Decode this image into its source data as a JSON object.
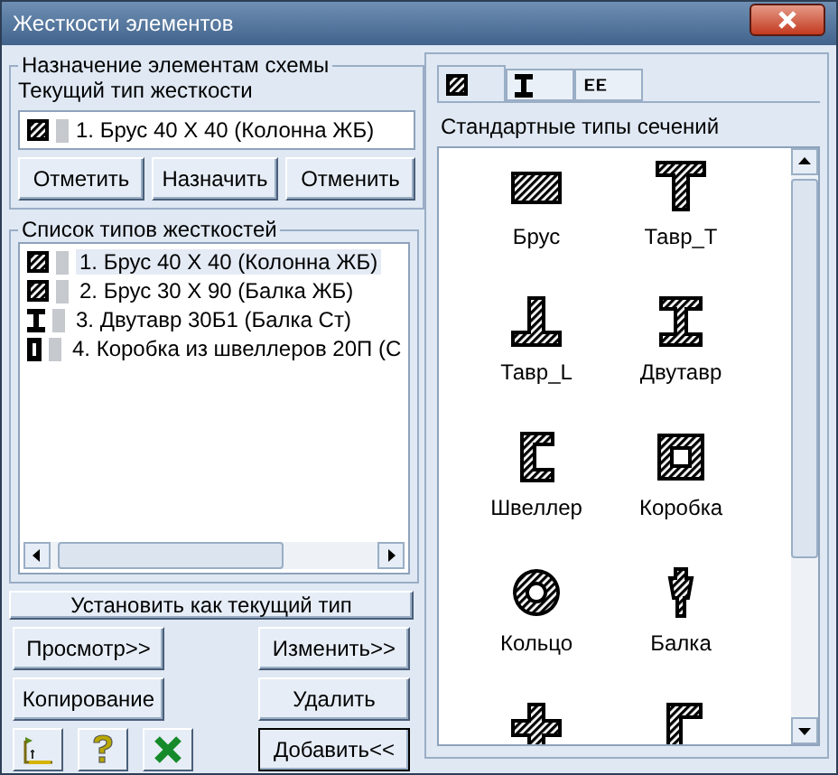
{
  "window": {
    "title": "Жесткости элементов"
  },
  "assignment": {
    "title": "Назначение элементам схемы",
    "current_label": "Текущий тип жесткости",
    "current": {
      "kind": "rect",
      "text": "1. Брус 40 X 40 (Колонна ЖБ)"
    },
    "buttons": [
      "Отметить",
      "Назначить",
      "Отменить"
    ]
  },
  "types_list": {
    "title": "Список типов жесткостей",
    "items": [
      {
        "kind": "rect",
        "text": "1. Брус 40 X 40 (Колонна ЖБ)",
        "selected": true
      },
      {
        "kind": "rect",
        "text": "2. Брус 30 X 90 (Балка ЖБ)",
        "selected": false
      },
      {
        "kind": "ibeam",
        "text": "3. Двутавр 30Б1 (Балка Ст)",
        "selected": false
      },
      {
        "kind": "box",
        "text": "4. Коробка из швеллеров 20П (С",
        "selected": false
      }
    ]
  },
  "set_current_button": "Установить как текущий тип",
  "action_buttons": [
    [
      "Просмотр>>",
      "Изменить>>"
    ],
    [
      "Копирование",
      "Удалить"
    ]
  ],
  "add_button": "Добавить<<",
  "tabs": [
    {
      "kind": "rect",
      "selected": true
    },
    {
      "kind": "ibeam",
      "selected": false
    },
    {
      "kind": "multi",
      "selected": false
    }
  ],
  "sections_label": "Стандартные типы сечений",
  "sections": [
    {
      "kind": "rect",
      "label": "Брус"
    },
    {
      "kind": "tee",
      "label": "Тавр_Т"
    },
    {
      "kind": "tee_l",
      "label": "Тавр_L"
    },
    {
      "kind": "ibeam",
      "label": "Двутавр"
    },
    {
      "kind": "channel",
      "label": "Швеллер"
    },
    {
      "kind": "box",
      "label": "Коробка"
    },
    {
      "kind": "ring",
      "label": "Кольцо"
    },
    {
      "kind": "beam",
      "label": "Балка"
    },
    {
      "kind": "cross"
    },
    {
      "kind": "angle"
    }
  ]
}
